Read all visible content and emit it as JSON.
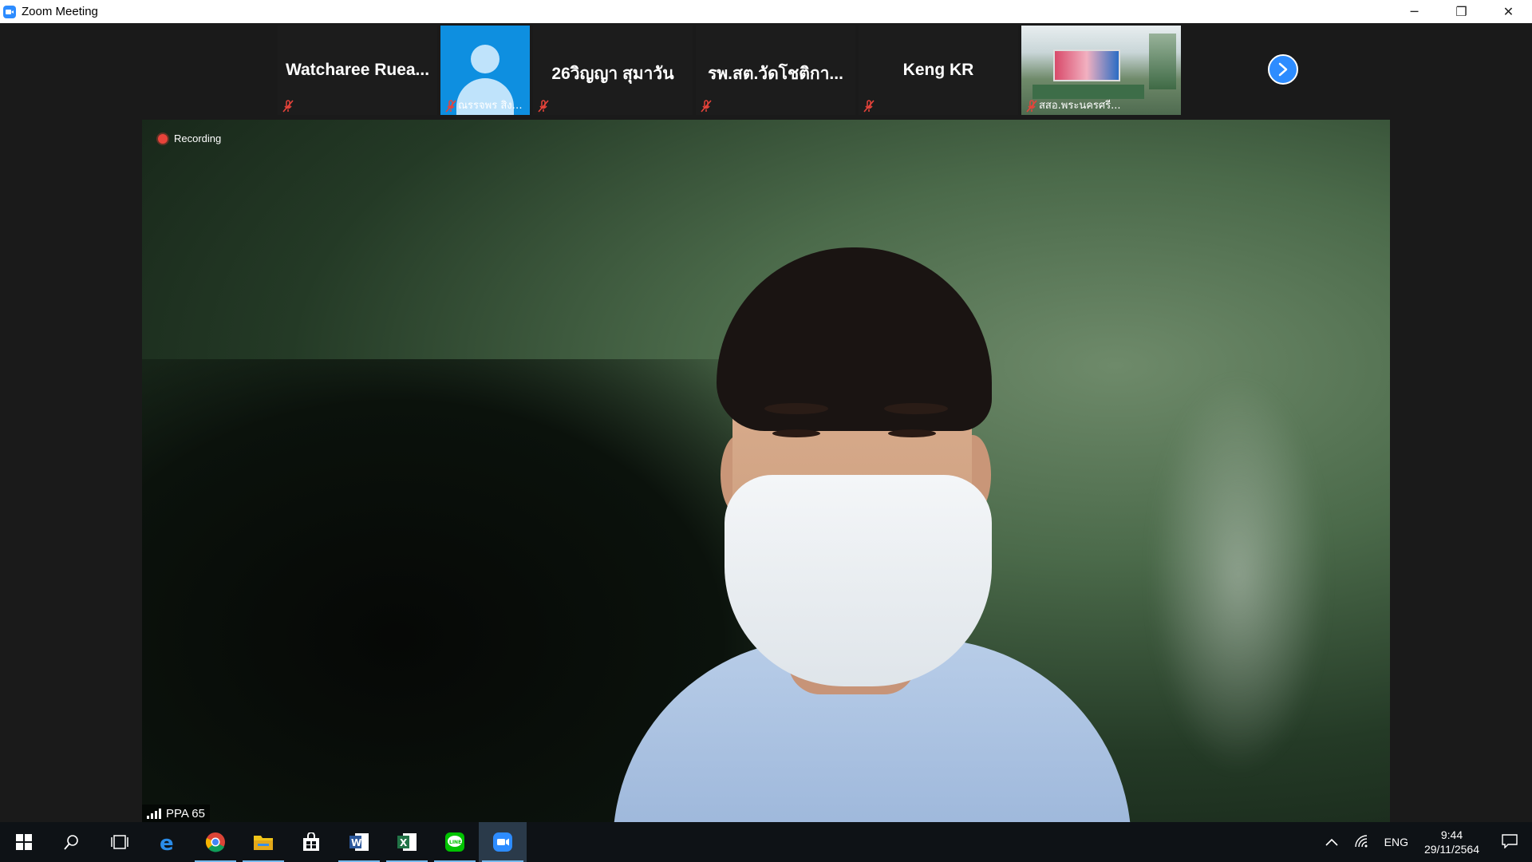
{
  "window": {
    "title": "Zoom Meeting",
    "minimize": "─",
    "restore": "❐",
    "close": "✕"
  },
  "gallery": [
    {
      "type": "name",
      "name": "Watcharee  Ruea...",
      "label": ""
    },
    {
      "type": "avatar",
      "name": "",
      "label": "ณรรจพร สิงห์สร..."
    },
    {
      "type": "name",
      "name": "26วิญญา สุมาวัน",
      "label": ""
    },
    {
      "type": "name",
      "name": "รพ.สต.วัดโชติกา...",
      "label": ""
    },
    {
      "type": "name",
      "name": "Keng KR",
      "label": ""
    },
    {
      "type": "photo",
      "name": "",
      "label": "สสอ.พระนครศรี..."
    }
  ],
  "recording": {
    "label": "Recording"
  },
  "active_speaker": {
    "name": "PPA 65"
  },
  "taskbar": {
    "apps": [
      "start",
      "search",
      "task-view",
      "edge",
      "chrome",
      "file-explorer",
      "store",
      "word",
      "excel",
      "line",
      "zoom"
    ],
    "tray": {
      "language": "ENG",
      "time": "9:44",
      "date": "29/11/2564"
    }
  },
  "colors": {
    "zoom_blue": "#2d8cff",
    "mute_red": "#e8433a",
    "taskbar_bg": "#0e1216"
  }
}
